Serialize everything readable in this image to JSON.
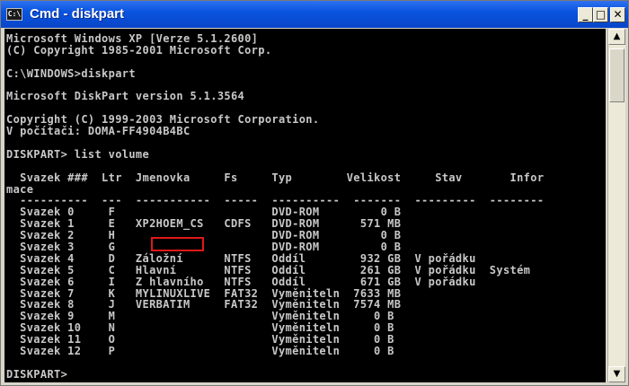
{
  "window": {
    "title": "Cmd - diskpart",
    "icon_label": "C:\\",
    "buttons": {
      "minimize": "_",
      "maximize": "□",
      "close": "✕"
    }
  },
  "console_lines": [
    "Microsoft Windows XP [Verze 5.1.2600]",
    "(C) Copyright 1985-2001 Microsoft Corp.",
    "",
    "C:\\WINDOWS>diskpart",
    "",
    "Microsoft DiskPart version 5.1.3564",
    "",
    "Copyright (C) 1999-2003 Microsoft Corporation.",
    "V počítači: DOMA-FF4904B4BC",
    "",
    "DISKPART> list volume",
    "",
    "  Svazek ###  Ltr  Jmenovka     Fs     Typ        Velikost     Stav       Infor",
    "mace",
    "  ----------  ---  -----------  -----  ----------  -------  ---------  --------",
    "  Svazek 0     F                       DVD-ROM         0 B",
    "  Svazek 1     E   XP2HOEM_CS   CDFS   DVD-ROM      571 MB",
    "  Svazek 2     H                       DVD-ROM         0 B",
    "  Svazek 3     G                       DVD-ROM         0 B",
    "  Svazek 4     D   Záložní      NTFS   Oddíl        932 GB  V pořádku",
    "  Svazek 5     C   Hlavní       NTFS   Oddíl        261 GB  V pořádku  Systém",
    "  Svazek 6     I   Z hlavního   NTFS   Oddíl        671 GB  V pořádku",
    "  Svazek 7     K   MYLINUXLIVE  FAT32  Vyměniteln  7633 MB",
    "  Svazek 8     J   VERBATIM     FAT32  Vyměniteln  7574 MB",
    "  Svazek 9     M                       Vyměniteln     0 B",
    "  Svazek 10    N                       Vyměniteln     0 B",
    "  Svazek 11    O                       Vyměniteln     0 B",
    "  Svazek 12    P                       Vyměniteln     0 B",
    "",
    "DISKPART>"
  ],
  "scrollbar": {
    "up_arrow": "▲",
    "down_arrow": "▼"
  },
  "colors": {
    "console_bg": "#000000",
    "console_text": "#c8c8c8",
    "titlebar": "#0a54e0",
    "highlight": "#e01818"
  }
}
